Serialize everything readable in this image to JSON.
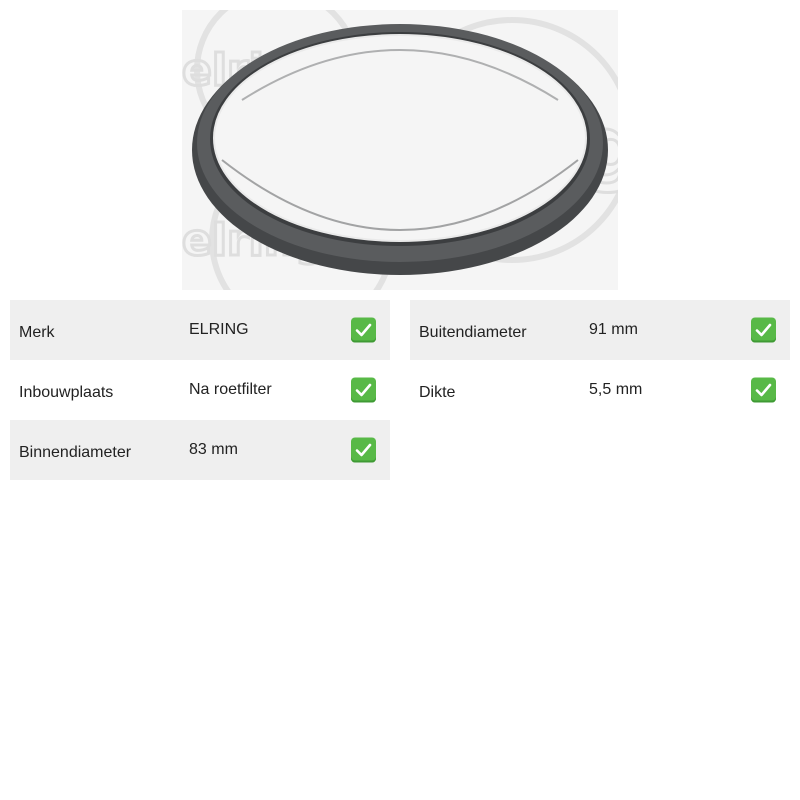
{
  "product": {
    "image_alt": "Afdichtring",
    "watermark_text": "elring",
    "colors": {
      "row_shade": "#efefef",
      "check_bg": "#58b947",
      "ring": "#545658"
    }
  },
  "specs_left": [
    {
      "label": "Merk",
      "value": "ELRING",
      "checked": true
    },
    {
      "label": "Inbouwplaats",
      "value": "Na roetfilter",
      "checked": true
    },
    {
      "label": "Binnendiameter",
      "value": "83 mm",
      "checked": true
    }
  ],
  "specs_right": [
    {
      "label": "Buitendiameter",
      "value": "91 mm",
      "checked": true
    },
    {
      "label": "Dikte",
      "value": "5,5 mm",
      "checked": true
    }
  ],
  "icons": {
    "check": "check-mark-icon"
  }
}
